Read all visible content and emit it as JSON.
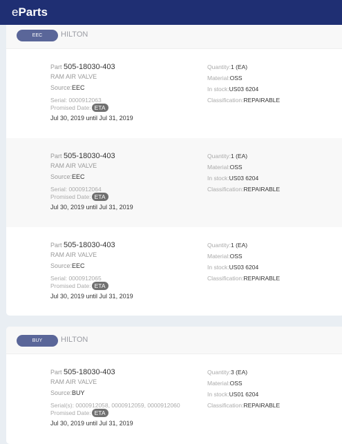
{
  "app": {
    "title_prefix": "e",
    "title_rest": "Parts"
  },
  "labels": {
    "part": "Part ",
    "source": "Source:",
    "promised": "Promised Date:",
    "eta": "ETA",
    "quantity": "Quantity:",
    "material": "Material:",
    "in_stock": "In stock:",
    "classification": "Classification:"
  },
  "groups": [
    {
      "badge": "EEC",
      "location": "HILTON",
      "items": [
        {
          "part": "505-18030-403",
          "name": "RAM AIR VALVE",
          "source": "EEC",
          "serial": "Serial: 0000912063",
          "dates": "Jul 30, 2019 until Jul 31, 2019",
          "quantity": "1 (EA)",
          "material": "OSS",
          "in_stock": "US03 6204",
          "classification": "REPAIRABLE"
        },
        {
          "part": "505-18030-403",
          "name": "RAM AIR VALVE",
          "source": "EEC",
          "serial": "Serial: 0000912064",
          "dates": "Jul 30, 2019 until Jul 31, 2019",
          "quantity": "1 (EA)",
          "material": "OSS",
          "in_stock": "US03 6204",
          "classification": "REPAIRABLE"
        },
        {
          "part": "505-18030-403",
          "name": "RAM AIR VALVE",
          "source": "EEC",
          "serial": "Serial: 0000912065",
          "dates": "Jul 30, 2019 until Jul 31, 2019",
          "quantity": "1 (EA)",
          "material": "OSS",
          "in_stock": "US03 6204",
          "classification": "REPAIRABLE"
        }
      ]
    },
    {
      "badge": "BUY",
      "location": "HILTON",
      "items": [
        {
          "part": "505-18030-403",
          "name": "RAM AIR VALVE",
          "source": "BUY",
          "serial": "Serial(s): 0000912058, 0000912059, 0000912060",
          "dates": "Jul 30, 2019 until Jul 31, 2019",
          "quantity": "3 (EA)",
          "material": "OSS",
          "in_stock": "US01 6204",
          "classification": "REPAIRABLE"
        }
      ]
    }
  ]
}
